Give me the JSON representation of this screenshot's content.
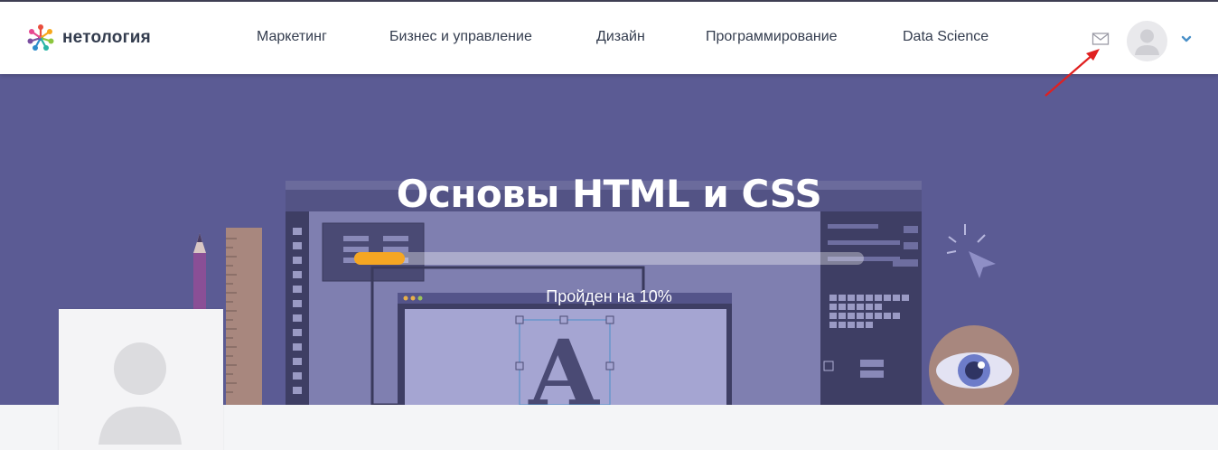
{
  "header": {
    "logo_text": "нетология",
    "nav": [
      {
        "label": "Маркетинг"
      },
      {
        "label": "Бизнес и управление"
      },
      {
        "label": "Дизайн"
      },
      {
        "label": "Программирование"
      },
      {
        "label": "Data Science"
      }
    ],
    "icons": {
      "mail": "envelope-icon",
      "avatar": "user-avatar-icon",
      "dropdown": "chevron-down-icon"
    },
    "accent_color": "#4a90c8"
  },
  "hero": {
    "title": "Основы HTML и CSS",
    "progress_percent": 10,
    "progress_text": "Пройден на 10%",
    "background_color": "#5b5b94",
    "progress_color": "#f5a623"
  },
  "annotation": {
    "color": "#e02020"
  }
}
